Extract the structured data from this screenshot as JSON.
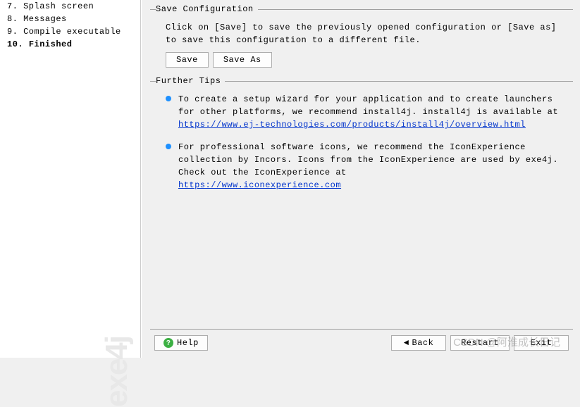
{
  "sidebar": {
    "steps": [
      {
        "num": "7.",
        "label": "Splash screen"
      },
      {
        "num": "8.",
        "label": "Messages"
      },
      {
        "num": "9.",
        "label": "Compile executable"
      },
      {
        "num": "10.",
        "label": "Finished"
      }
    ],
    "watermark": "exe4j"
  },
  "save_config": {
    "title": "Save Configuration",
    "desc": "Click on [Save] to save the previously opened configuration or [Save as] to save this configuration to a different file.",
    "save_label": "Save",
    "save_as_label": "Save As"
  },
  "tips": {
    "title": "Further Tips",
    "items": [
      {
        "text": "To create a setup wizard for your application and to create launchers for other platforms, we recommend install4j. install4j is available at",
        "link": "https://www.ej-technologies.com/products/install4j/overview.html"
      },
      {
        "text": "For professional software icons, we recommend the IconExperience collection by Incors. Icons from the IconExperience are used by exe4j. Check out the IconExperience at",
        "link": "https://www.iconexperience.com"
      }
    ]
  },
  "footer": {
    "help": "Help",
    "back": "Back",
    "restart": "Restart",
    "exit": "Exit"
  },
  "watermark": "CSDN @阿淮成长日记"
}
